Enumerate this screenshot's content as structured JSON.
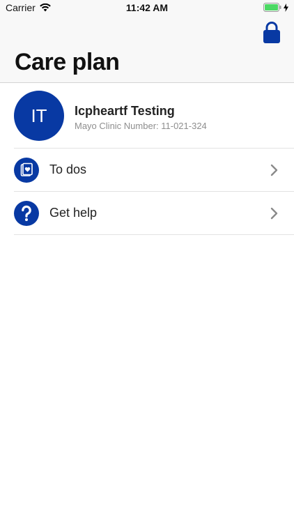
{
  "status_bar": {
    "carrier": "Carrier",
    "time": "11:42 AM",
    "battery_color": "#4cd964"
  },
  "header": {
    "title": "Care plan",
    "lock_icon": "lock-icon"
  },
  "profile": {
    "initials": "IT",
    "name": "Icpheartf Testing",
    "clinic_number": "Mayo Clinic Number: 11-021-324",
    "avatar_color": "#0839a3"
  },
  "menu": {
    "items": [
      {
        "label": "To dos",
        "icon": "heart-card-icon"
      },
      {
        "label": "Get help",
        "icon": "question-icon"
      }
    ]
  },
  "colors": {
    "brand": "#0839a3",
    "separator": "#e2e2e2",
    "header_bg": "#f8f8f8"
  }
}
